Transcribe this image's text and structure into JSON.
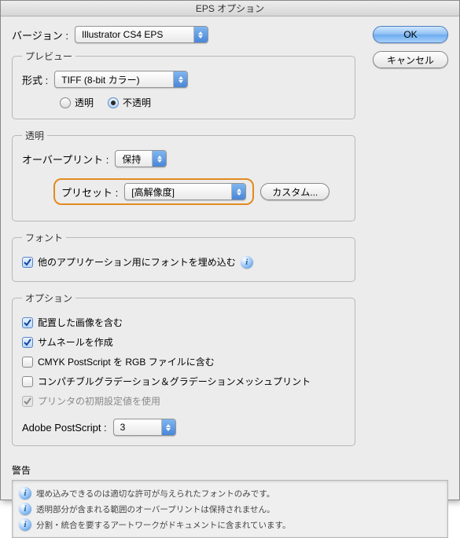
{
  "window": {
    "title": "EPS オプション"
  },
  "buttons": {
    "ok": "OK",
    "cancel": "キャンセル",
    "custom": "カスタム..."
  },
  "version": {
    "label": "バージョン :",
    "value": "Illustrator CS4 EPS"
  },
  "preview": {
    "legend": "プレビュー",
    "format_label": "形式 :",
    "format_value": "TIFF (8-bit カラー)",
    "transparent": "透明",
    "opaque": "不透明"
  },
  "transparency": {
    "legend": "透明",
    "overprint_label": "オーバープリント :",
    "overprint_value": "保持",
    "preset_label": "プリセット :",
    "preset_value": "[高解像度]"
  },
  "font": {
    "legend": "フォント",
    "embed": "他のアプリケーション用にフォントを埋め込む"
  },
  "options": {
    "legend": "オプション",
    "include_placed": "配置した画像を含む",
    "thumbnail": "サムネールを作成",
    "cmyk_rgb": "CMYK PostScript を RGB ファイルに含む",
    "compatible_gradient": "コンパチブルグラデーション＆グラデーションメッシュプリント",
    "printer_defaults": "プリンタの初期設定値を使用",
    "postscript_label": "Adobe PostScript :",
    "postscript_value": "3"
  },
  "warnings": {
    "title": "警告",
    "items": [
      "埋め込みできるのは適切な許可が与えられたフォントのみです。",
      "透明部分が含まれる範囲のオーバープリントは保持されません。",
      "分割・統合を要するアートワークがドキュメントに含まれています。"
    ]
  }
}
